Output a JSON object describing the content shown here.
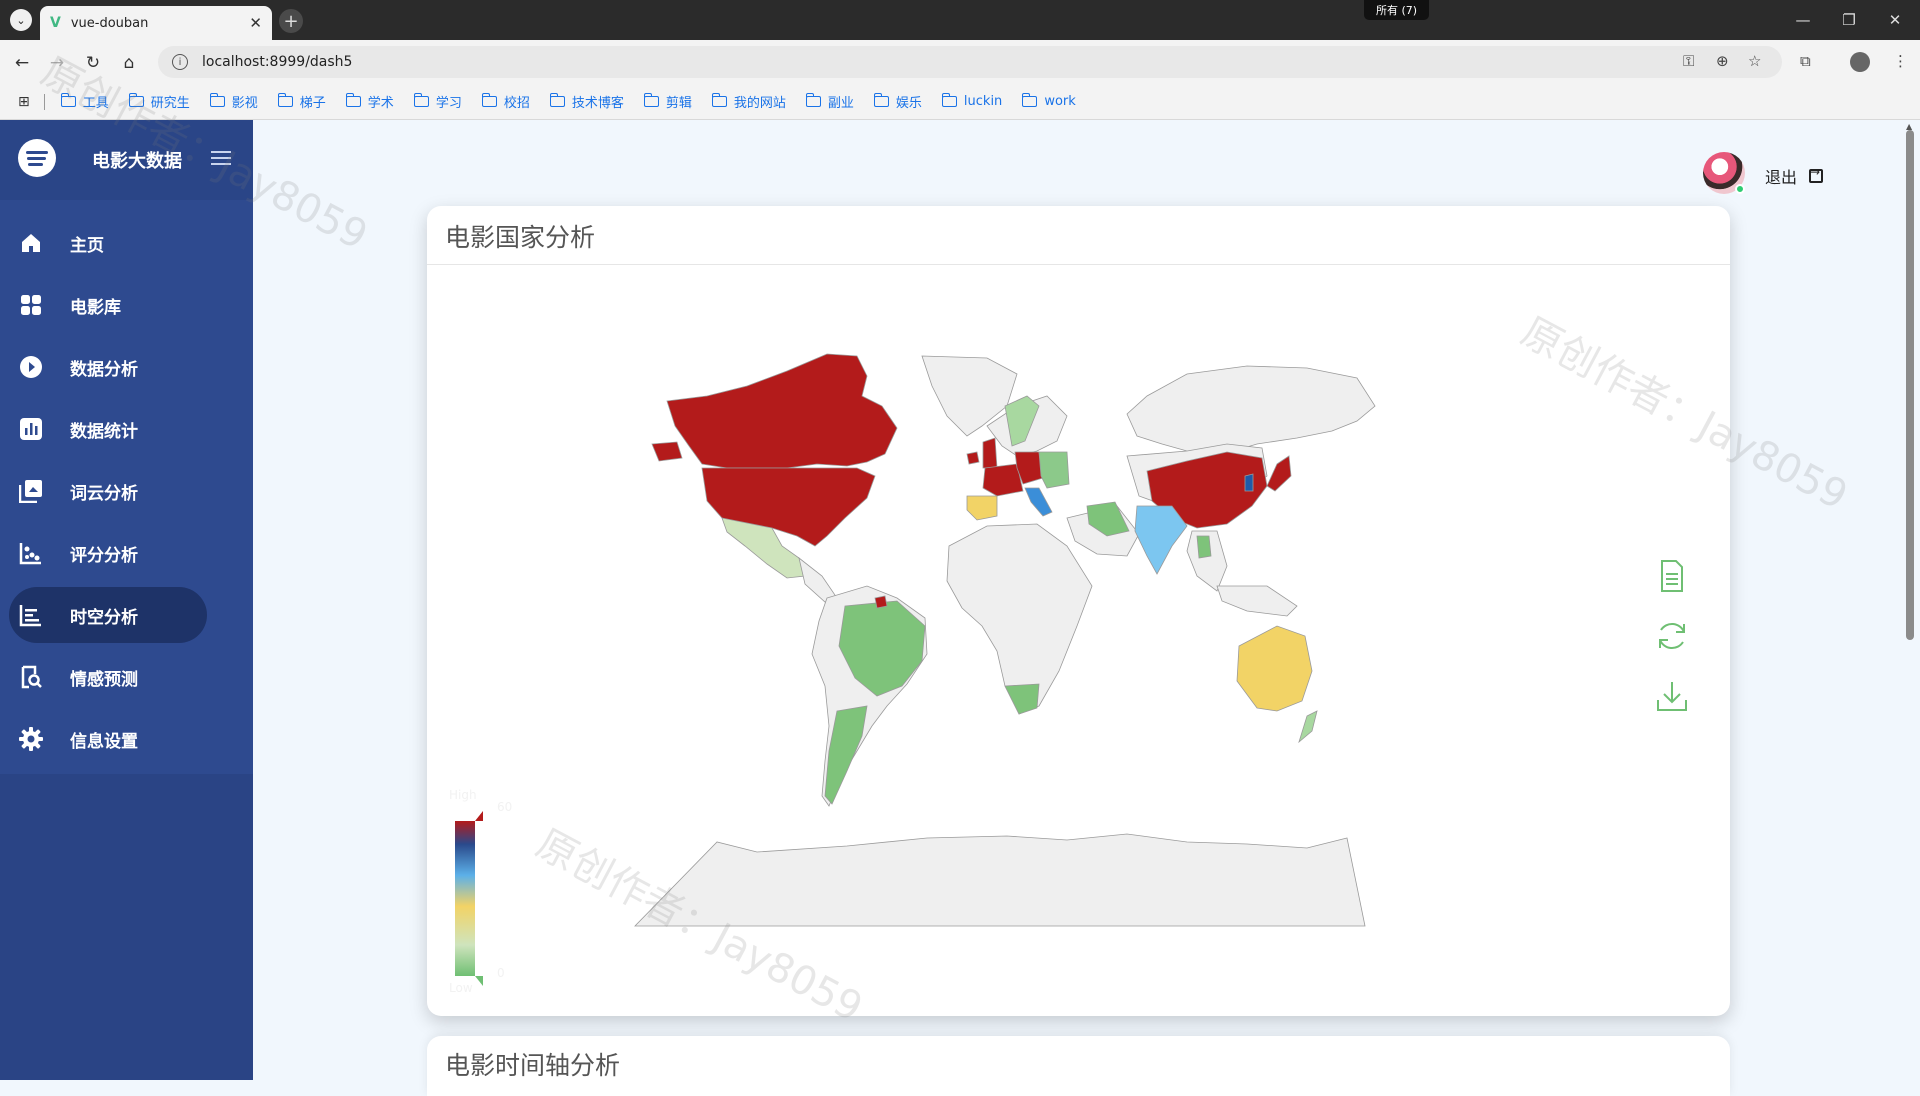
{
  "browser": {
    "tab_title": "vue-douban",
    "all_tabs_badge": "所有 (7)",
    "url": "localhost:8999/dash5",
    "bookmarks": [
      "工具",
      "研究生",
      "影视",
      "梯子",
      "学术",
      "学习",
      "校招",
      "技术博客",
      "剪辑",
      "我的网站",
      "副业",
      "娱乐",
      "luckin",
      "work"
    ]
  },
  "sidebar": {
    "title": "电影大数据",
    "items": [
      {
        "label": "主页",
        "icon": "home-icon"
      },
      {
        "label": "电影库",
        "icon": "grid-icon"
      },
      {
        "label": "数据分析",
        "icon": "play-circle-icon"
      },
      {
        "label": "数据统计",
        "icon": "bar-chart-icon"
      },
      {
        "label": "词云分析",
        "icon": "image-gallery-icon"
      },
      {
        "label": "评分分析",
        "icon": "scatter-chart-icon"
      },
      {
        "label": "时空分析",
        "icon": "timeline-chart-icon",
        "active": true
      },
      {
        "label": "情感预测",
        "icon": "search-doc-icon"
      },
      {
        "label": "信息设置",
        "icon": "gear-icon"
      }
    ]
  },
  "header": {
    "logout_label": "退出"
  },
  "cards": {
    "map_title": "电影国家分析",
    "timeline_title": "电影时间轴分析"
  },
  "visual_map": {
    "high_label": "High",
    "low_label": "Low",
    "max": "60",
    "min": "0"
  },
  "watermark": "原创作者：Jay8059",
  "colors": {
    "sidebar": "#2e4a8f",
    "active": "#1e3368",
    "high": "#b31b1b",
    "mid": "#f2d366",
    "low": "#6fbf73"
  }
}
